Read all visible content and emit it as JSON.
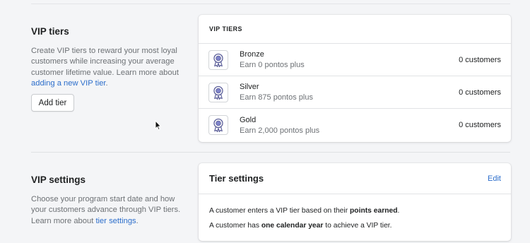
{
  "vip_tiers_section": {
    "title": "VIP tiers",
    "description": "Create VIP tiers to reward your most loyal customers while increasing your average customer lifetime value. Learn more about ",
    "link_text": "adding a new VIP tier",
    "link_suffix": ".",
    "add_button_label": "Add tier"
  },
  "tiers_card": {
    "header": "VIP TIERS",
    "tiers": [
      {
        "name": "Bronze",
        "requirement": "Earn 0 pontos plus",
        "customers": "0 customers",
        "icon": "medal-icon"
      },
      {
        "name": "Silver",
        "requirement": "Earn 875 pontos plus",
        "customers": "0 customers",
        "icon": "medal-icon"
      },
      {
        "name": "Gold",
        "requirement": "Earn 2,000 pontos plus",
        "customers": "0 customers",
        "icon": "medal-icon"
      }
    ]
  },
  "vip_settings_section": {
    "title": "VIP settings",
    "description": "Choose your program start date and how your customers advance through VIP tiers. Learn more about ",
    "link_text": "tier settings",
    "link_suffix": "."
  },
  "tier_settings_card": {
    "title": "Tier settings",
    "edit_label": "Edit",
    "line1_prefix": "A customer enters a VIP tier based on their ",
    "line1_bold": "points earned",
    "line1_suffix": ".",
    "line2_prefix": "A customer has ",
    "line2_bold": "one calendar year",
    "line2_suffix": " to achieve a VIP tier."
  },
  "colors": {
    "accent": "#2c6ecb",
    "medal": "#5c5f99",
    "page_bg": "#f4f5f7"
  }
}
